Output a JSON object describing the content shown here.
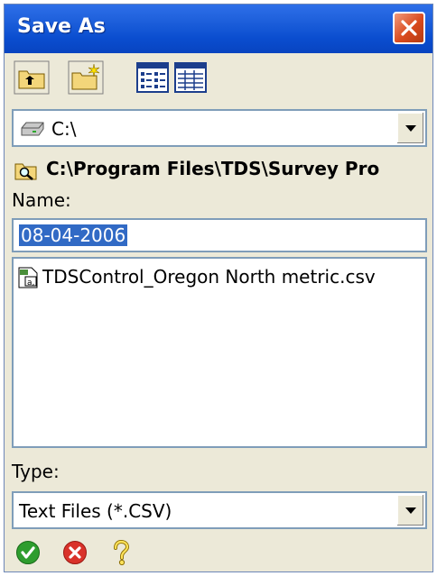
{
  "window": {
    "title": "Save As"
  },
  "toolbar": {
    "buttons": [
      {
        "name": "up-folder"
      },
      {
        "name": "new-folder"
      },
      {
        "name": "list-view"
      },
      {
        "name": "details-view"
      }
    ]
  },
  "drive": {
    "selected": "C:\\"
  },
  "current_path": "C:\\Program Files\\TDS\\Survey Pro",
  "name_field": {
    "label": "Name:",
    "value": "08-04-2006"
  },
  "files": [
    {
      "name": "TDSControl_Oregon North metric.csv"
    }
  ],
  "type_field": {
    "label": "Type:",
    "selected": "Text Files (*.CSV)"
  },
  "colors": {
    "titlebar": "#0a4dcf",
    "selection": "#316ac5",
    "ok": "#2e9d2e",
    "cancel": "#d9322a"
  }
}
